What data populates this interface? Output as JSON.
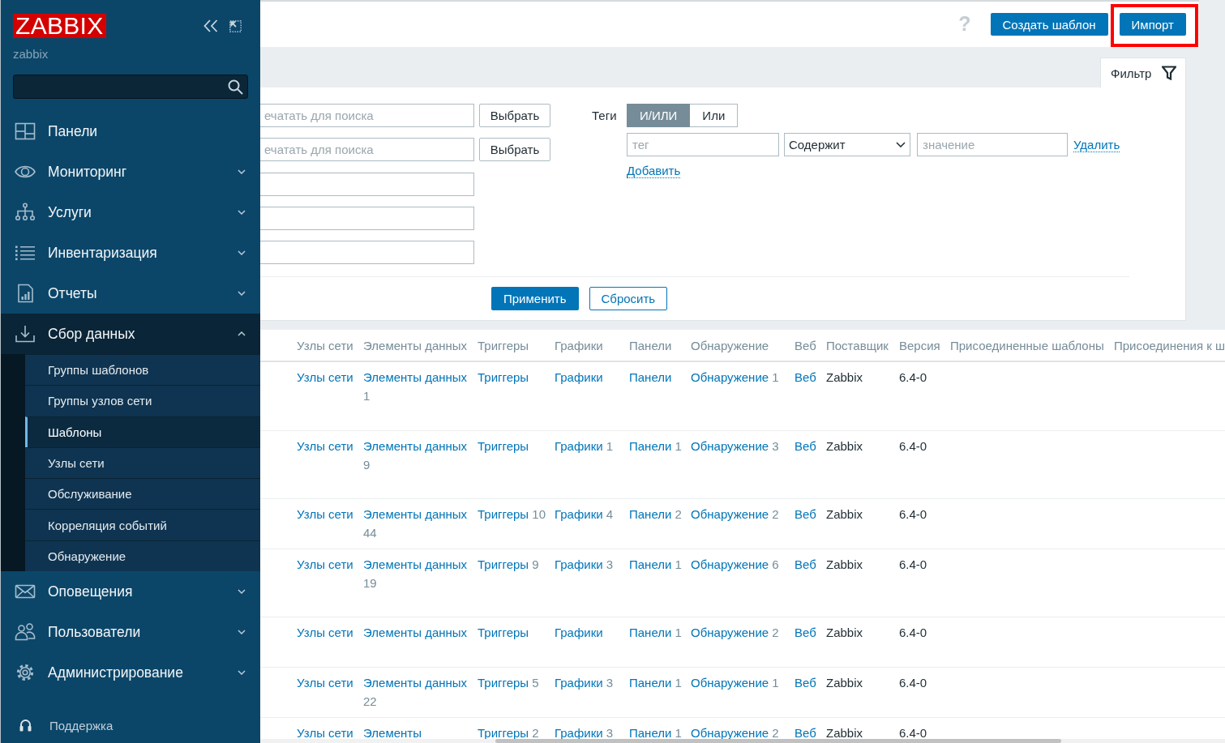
{
  "sidebar": {
    "logo": "ZABBIX",
    "server_name": "zabbix",
    "menu": [
      {
        "label": "Панели",
        "kind": "link",
        "expanded": false
      },
      {
        "label": "Мониторинг",
        "kind": "group",
        "expanded": false
      },
      {
        "label": "Услуги",
        "kind": "group",
        "expanded": false
      },
      {
        "label": "Инвентаризация",
        "kind": "group",
        "expanded": false
      },
      {
        "label": "Отчеты",
        "kind": "group",
        "expanded": false
      },
      {
        "label": "Сбор данных",
        "kind": "group",
        "expanded": true,
        "children": [
          {
            "label": "Группы шаблонов",
            "selected": false
          },
          {
            "label": "Группы узлов сети",
            "selected": false
          },
          {
            "label": "Шаблоны",
            "selected": true
          },
          {
            "label": "Узлы сети",
            "selected": false
          },
          {
            "label": "Обслуживание",
            "selected": false
          },
          {
            "label": "Корреляция событий",
            "selected": false
          },
          {
            "label": "Обнаружение",
            "selected": false
          }
        ]
      },
      {
        "label": "Оповещения",
        "kind": "group",
        "expanded": false
      },
      {
        "label": "Пользователи",
        "kind": "group",
        "expanded": false
      },
      {
        "label": "Администрирование",
        "kind": "group",
        "expanded": false
      }
    ],
    "support": "Поддержка"
  },
  "header": {
    "help": "?",
    "buttons": [
      {
        "label": "Создать шаблон",
        "highlighted": false
      },
      {
        "label": "Импорт",
        "highlighted": true
      }
    ]
  },
  "filter": {
    "tab": {
      "label": "Фильтр",
      "selected": true
    },
    "fields": [
      {
        "kind": "picker",
        "placeholder": "ечатать для поиска",
        "button": "Выбрать"
      },
      {
        "kind": "picker",
        "placeholder": "ечатать для поиска",
        "button": "Выбрать"
      },
      {
        "kind": "text"
      },
      {
        "kind": "text"
      },
      {
        "kind": "text"
      }
    ],
    "tags": {
      "label": "Теги",
      "operators": [
        {
          "label": "И/ИЛИ",
          "selected": true
        },
        {
          "label": "Или",
          "selected": false
        }
      ],
      "rows": [
        {
          "tag_placeholder": "тег",
          "operator": "Содержит",
          "value_placeholder": "значение",
          "remove": "Удалить"
        }
      ],
      "add": "Добавить"
    },
    "apply": "Применить",
    "reset": "Сбросить"
  },
  "table": {
    "columns": [
      "Узлы сети",
      "Элементы данных",
      "Триггеры",
      "Графики",
      "Панели",
      "Обнаружение",
      "Веб",
      "Поставщик",
      "Версия",
      "Присоединенные шаблоны",
      "Присоединения к ш"
    ],
    "rows": [
      {
        "cells": [
          {
            "kind": "link",
            "text": "Узлы сети"
          },
          {
            "kind": "link",
            "text": "Элементы данных",
            "count": "1"
          },
          {
            "kind": "link",
            "text": "Триггеры"
          },
          {
            "kind": "link",
            "text": "Графики"
          },
          {
            "kind": "link",
            "text": "Панели"
          },
          {
            "kind": "link",
            "text": "Обнаружение",
            "count": "1"
          },
          {
            "kind": "link",
            "text": "Веб"
          },
          {
            "kind": "text",
            "text": "Zabbix"
          },
          {
            "kind": "text",
            "text": "6.4-0"
          }
        ]
      },
      {
        "cells": [
          {
            "kind": "link",
            "text": "Узлы сети"
          },
          {
            "kind": "link",
            "text": "Элементы данных",
            "count": "9"
          },
          {
            "kind": "link",
            "text": "Триггеры"
          },
          {
            "kind": "link",
            "text": "Графики",
            "count": "1"
          },
          {
            "kind": "link",
            "text": "Панели",
            "count": "1"
          },
          {
            "kind": "link",
            "text": "Обнаружение",
            "count": "3"
          },
          {
            "kind": "link",
            "text": "Веб"
          },
          {
            "kind": "text",
            "text": "Zabbix"
          },
          {
            "kind": "text",
            "text": "6.4-0"
          }
        ]
      },
      {
        "cells": [
          {
            "kind": "link",
            "text": "Узлы сети"
          },
          {
            "kind": "link",
            "text": "Элементы данных",
            "count": "44"
          },
          {
            "kind": "link",
            "text": "Триггеры",
            "count": "10"
          },
          {
            "kind": "link",
            "text": "Графики",
            "count": "4"
          },
          {
            "kind": "link",
            "text": "Панели",
            "count": "2"
          },
          {
            "kind": "link",
            "text": "Обнаружение",
            "count": "2"
          },
          {
            "kind": "link",
            "text": "Веб"
          },
          {
            "kind": "text",
            "text": "Zabbix"
          },
          {
            "kind": "text",
            "text": "6.4-0"
          }
        ]
      },
      {
        "cells": [
          {
            "kind": "link",
            "text": "Узлы сети"
          },
          {
            "kind": "link",
            "text": "Элементы данных",
            "count": "19"
          },
          {
            "kind": "link",
            "text": "Триггеры",
            "count": "9"
          },
          {
            "kind": "link",
            "text": "Графики",
            "count": "3"
          },
          {
            "kind": "link",
            "text": "Панели",
            "count": "1"
          },
          {
            "kind": "link",
            "text": "Обнаружение",
            "count": "6"
          },
          {
            "kind": "link",
            "text": "Веб"
          },
          {
            "kind": "text",
            "text": "Zabbix"
          },
          {
            "kind": "text",
            "text": "6.4-0"
          }
        ]
      },
      {
        "cells": [
          {
            "kind": "link",
            "text": "Узлы сети"
          },
          {
            "kind": "link",
            "text": "Элементы данных"
          },
          {
            "kind": "link",
            "text": "Триггеры"
          },
          {
            "kind": "link",
            "text": "Графики"
          },
          {
            "kind": "link",
            "text": "Панели",
            "count": "1"
          },
          {
            "kind": "link",
            "text": "Обнаружение",
            "count": "2"
          },
          {
            "kind": "link",
            "text": "Веб"
          },
          {
            "kind": "text",
            "text": "Zabbix"
          },
          {
            "kind": "text",
            "text": "6.4-0"
          }
        ]
      },
      {
        "cells": [
          {
            "kind": "link",
            "text": "Узлы сети"
          },
          {
            "kind": "link",
            "text": "Элементы данных",
            "count": "22"
          },
          {
            "kind": "link",
            "text": "Триггеры",
            "count": "5"
          },
          {
            "kind": "link",
            "text": "Графики",
            "count": "3"
          },
          {
            "kind": "link",
            "text": "Панели",
            "count": "1"
          },
          {
            "kind": "link",
            "text": "Обнаружение",
            "count": "1"
          },
          {
            "kind": "link",
            "text": "Веб"
          },
          {
            "kind": "text",
            "text": "Zabbix"
          },
          {
            "kind": "text",
            "text": "6.4-0"
          }
        ]
      },
      {
        "cells": [
          {
            "kind": "link",
            "text": "Узлы сети"
          },
          {
            "kind": "link",
            "text": "Элементы"
          },
          {
            "kind": "link",
            "text": "Триггеры",
            "count": "2"
          },
          {
            "kind": "link",
            "text": "Графики",
            "count": "3"
          },
          {
            "kind": "link",
            "text": "Панели",
            "count": "1"
          },
          {
            "kind": "link",
            "text": "Обнаружение",
            "count": "2"
          },
          {
            "kind": "link",
            "text": "Веб"
          },
          {
            "kind": "text",
            "text": "Zabbix"
          },
          {
            "kind": "text",
            "text": "6.4-0"
          }
        ]
      }
    ]
  }
}
